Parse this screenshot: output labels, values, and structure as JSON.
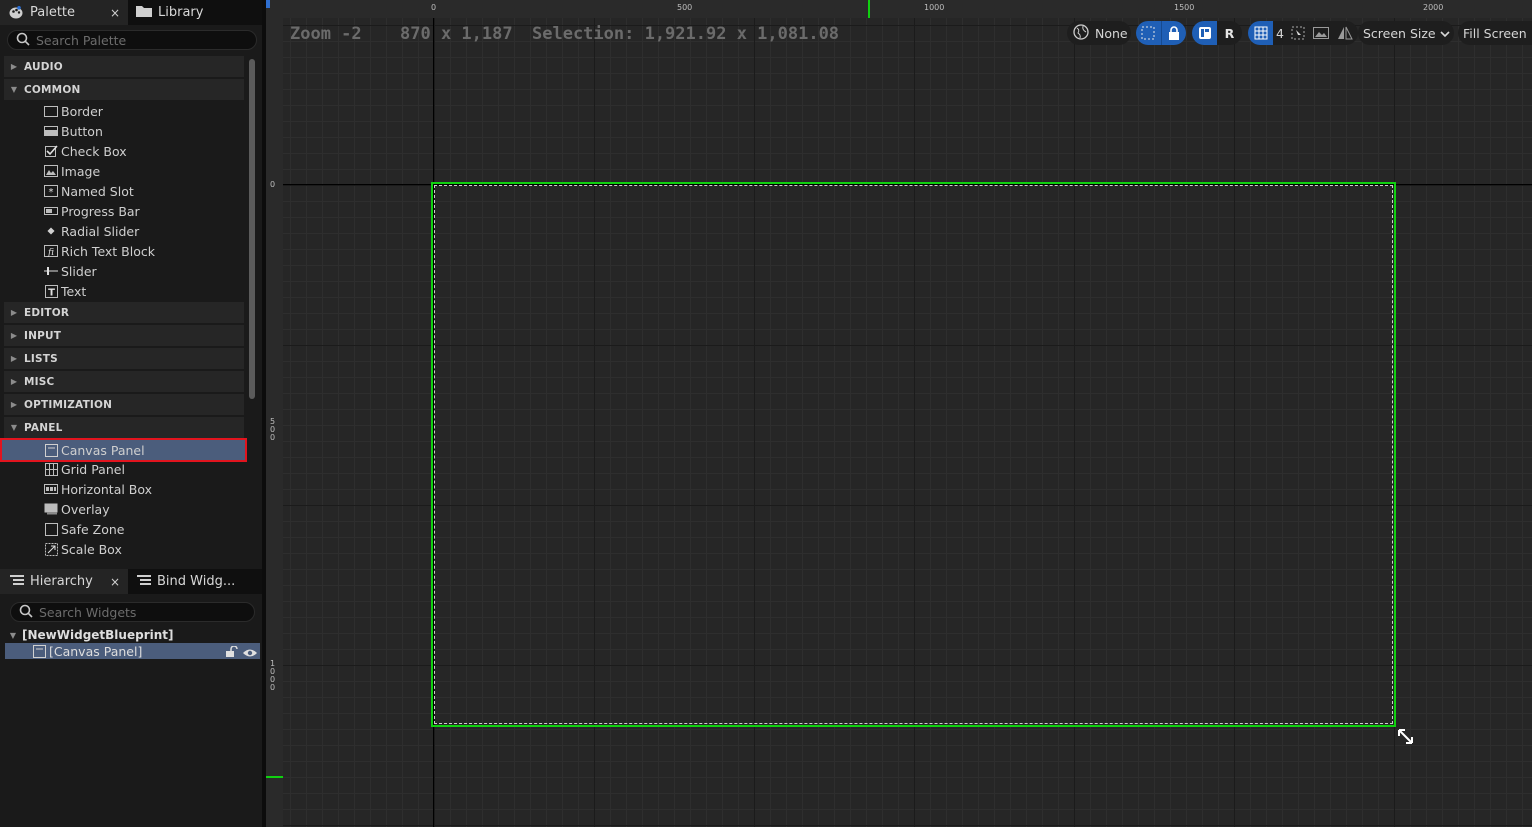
{
  "palette": {
    "tab_label": "Palette",
    "close_glyph": "×",
    "library_tab_label": "Library",
    "search_placeholder": "Search Palette",
    "categories": [
      {
        "label": "AUDIO",
        "expanded": false
      },
      {
        "label": "COMMON",
        "expanded": true
      },
      {
        "label": "EDITOR",
        "expanded": false
      },
      {
        "label": "INPUT",
        "expanded": false
      },
      {
        "label": "LISTS",
        "expanded": false
      },
      {
        "label": "MISC",
        "expanded": false
      },
      {
        "label": "OPTIMIZATION",
        "expanded": false
      },
      {
        "label": "PANEL",
        "expanded": true
      }
    ],
    "common_items": [
      {
        "label": "Border",
        "icon": "border-icon"
      },
      {
        "label": "Button",
        "icon": "button-icon"
      },
      {
        "label": "Check Box",
        "icon": "checkbox-icon"
      },
      {
        "label": "Image",
        "icon": "image-icon"
      },
      {
        "label": "Named Slot",
        "icon": "named-slot-icon"
      },
      {
        "label": "Progress Bar",
        "icon": "progress-bar-icon"
      },
      {
        "label": "Radial Slider",
        "icon": "radial-slider-icon"
      },
      {
        "label": "Rich Text Block",
        "icon": "rich-text-icon"
      },
      {
        "label": "Slider",
        "icon": "slider-icon"
      },
      {
        "label": "Text",
        "icon": "text-icon"
      }
    ],
    "panel_items": [
      {
        "label": "Canvas Panel",
        "icon": "canvas-panel-icon",
        "selected": true
      },
      {
        "label": "Grid Panel",
        "icon": "grid-panel-icon"
      },
      {
        "label": "Horizontal Box",
        "icon": "horizontal-box-icon"
      },
      {
        "label": "Overlay",
        "icon": "overlay-icon"
      },
      {
        "label": "Safe Zone",
        "icon": "safe-zone-icon"
      },
      {
        "label": "Scale Box",
        "icon": "scale-box-icon"
      }
    ]
  },
  "hierarchy": {
    "tab_label": "Hierarchy",
    "close_glyph": "×",
    "bind_tab_label": "Bind Widg...",
    "search_placeholder": "Search Widgets",
    "root_label": "[NewWidgetBlueprint]",
    "child_label": "[Canvas Panel]"
  },
  "designer": {
    "zoom_label": "Zoom -2",
    "size_label": "870 x 1,187",
    "selection_label": "Selection: 1,921.92 x 1,081.08",
    "ruler_x_labels": [
      "0",
      "500",
      "1000",
      "1500",
      "2000"
    ],
    "ruler_y_labels": [
      "0",
      "5\n0\n0",
      "1\n0\n0\n0"
    ],
    "toolbar": {
      "localization_label": "None",
      "respect_locks_letter": "R",
      "grid_snap_value": "4",
      "screen_size_label": "Screen Size",
      "fill_screen_label": "Fill Screen"
    },
    "accent_color": "#10d010",
    "selection_color": "#4b5d7c",
    "highlight_color": "#e2141e"
  }
}
